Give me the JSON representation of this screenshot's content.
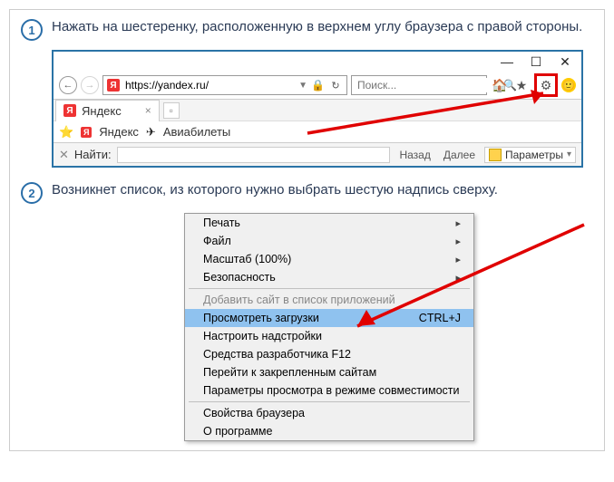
{
  "steps": {
    "s1": {
      "num": "1",
      "text": "Нажать на шестеренку, расположенную в верхнем углу браузера с правой стороны."
    },
    "s2": {
      "num": "2",
      "text": "Возникнет список, из которого нужно выбрать шестую надпись сверху."
    }
  },
  "browser": {
    "url": "https://yandex.ru/",
    "yandex_glyph": "Я",
    "search_placeholder": "Поиск...",
    "tab_title": "Яндекс",
    "bookmarks": {
      "yandex": "Яндекс",
      "avia": "Авиабилеты"
    },
    "find_label": "Найти:",
    "find_back": "Назад",
    "find_next": "Далее",
    "find_params": "Параметры"
  },
  "menu": {
    "print": "Печать",
    "file": "Файл",
    "zoom": "Масштаб (100%)",
    "safety": "Безопасность",
    "addapp": "Добавить сайт в список приложений",
    "downloads": "Просмотреть загрузки",
    "downloads_hotkey": "CTRL+J",
    "addons": "Настроить надстройки",
    "f12": "Средства разработчика F12",
    "pinned": "Перейти к закрепленным сайтам",
    "compat": "Параметры просмотра в режиме совместимости",
    "props": "Свойства браузера",
    "about": "О программе"
  }
}
